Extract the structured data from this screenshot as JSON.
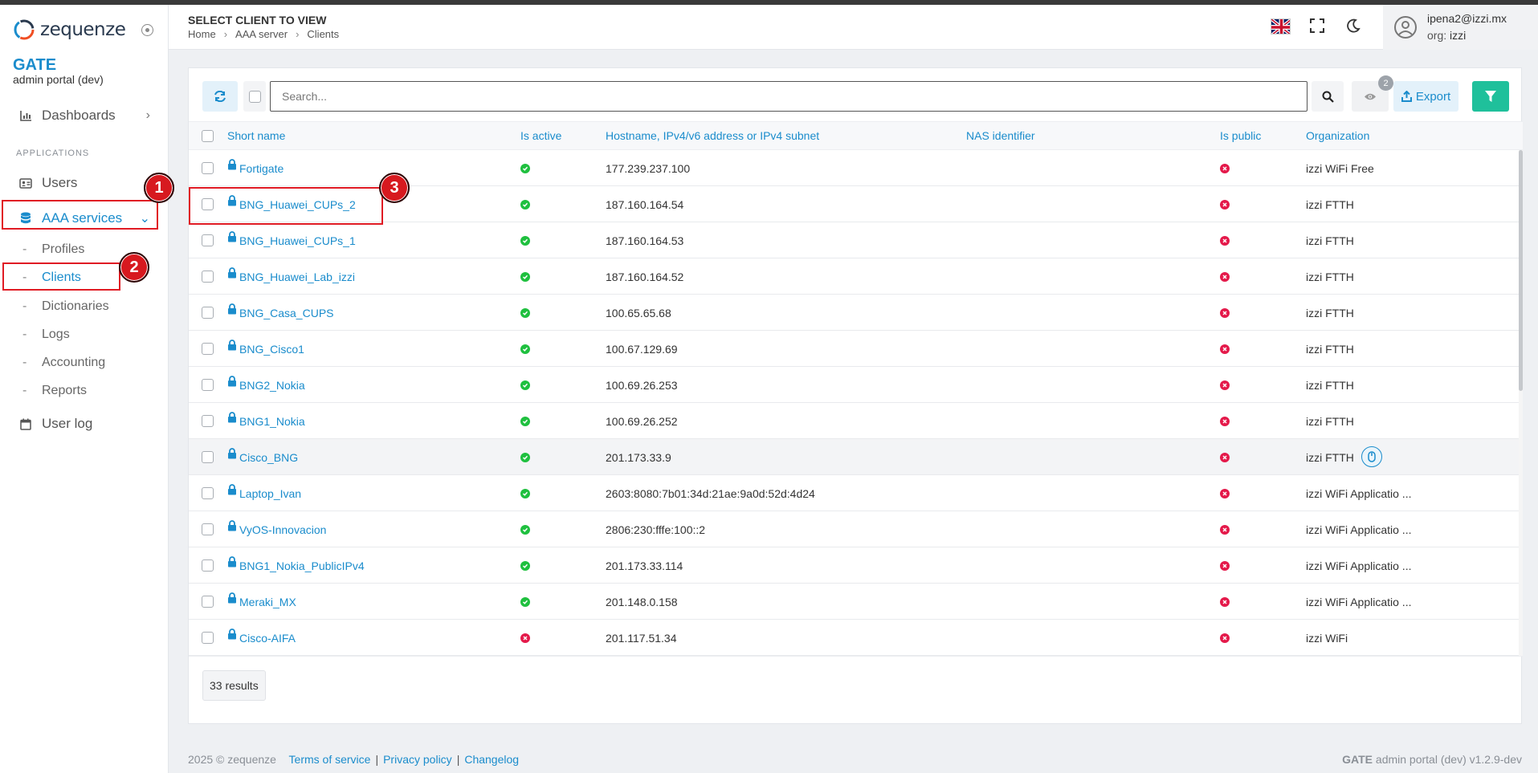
{
  "app": {
    "logo_text": "zequenze",
    "brand": "GATE",
    "brand_sub": "admin portal (dev)"
  },
  "sidebar": {
    "section_label": "APPLICATIONS",
    "items": [
      {
        "label": "Dashboards",
        "icon": "chart-icon"
      },
      {
        "label": "Users",
        "icon": "id-card-icon"
      },
      {
        "label": "AAA services",
        "icon": "database-icon"
      },
      {
        "label": "User log",
        "icon": "calendar-icon"
      }
    ],
    "sub_items": [
      {
        "label": "Profiles"
      },
      {
        "label": "Clients"
      },
      {
        "label": "Dictionaries"
      },
      {
        "label": "Logs"
      },
      {
        "label": "Accounting"
      },
      {
        "label": "Reports"
      }
    ]
  },
  "header": {
    "title": "SELECT CLIENT TO VIEW",
    "breadcrumb": [
      "Home",
      "AAA server",
      "Clients"
    ],
    "user_email": "ipena2@izzi.mx",
    "org_label": "org:",
    "org_value": "izzi"
  },
  "toolbar": {
    "search_placeholder": "Search...",
    "hidden_columns_count": "2",
    "export_label": "Export"
  },
  "table": {
    "columns": [
      "Short name",
      "Is active",
      "Hostname, IPv4/v6 address or IPv4 subnet",
      "NAS identifier",
      "Is public",
      "Organization"
    ],
    "rows": [
      {
        "name": "Fortigate",
        "active": true,
        "host": "177.239.237.100",
        "nas": "",
        "public": false,
        "org": "izzi WiFi Free"
      },
      {
        "name": "BNG_Huawei_CUPs_2",
        "active": true,
        "host": "187.160.164.54",
        "nas": "",
        "public": false,
        "org": "izzi FTTH"
      },
      {
        "name": "BNG_Huawei_CUPs_1",
        "active": true,
        "host": "187.160.164.53",
        "nas": "",
        "public": false,
        "org": "izzi FTTH"
      },
      {
        "name": "BNG_Huawei_Lab_izzi",
        "active": true,
        "host": "187.160.164.52",
        "nas": "",
        "public": false,
        "org": "izzi FTTH"
      },
      {
        "name": "BNG_Casa_CUPS",
        "active": true,
        "host": "100.65.65.68",
        "nas": "",
        "public": false,
        "org": "izzi FTTH"
      },
      {
        "name": "BNG_Cisco1",
        "active": true,
        "host": "100.67.129.69",
        "nas": "",
        "public": false,
        "org": "izzi FTTH"
      },
      {
        "name": "BNG2_Nokia",
        "active": true,
        "host": "100.69.26.253",
        "nas": "",
        "public": false,
        "org": "izzi FTTH"
      },
      {
        "name": "BNG1_Nokia",
        "active": true,
        "host": "100.69.26.252",
        "nas": "",
        "public": false,
        "org": "izzi FTTH"
      },
      {
        "name": "Cisco_BNG",
        "active": true,
        "host": "201.173.33.9",
        "nas": "",
        "public": false,
        "org": "izzi FTTH"
      },
      {
        "name": "Laptop_Ivan",
        "active": true,
        "host": "2603:8080:7b01:34d:21ae:9a0d:52d:4d24",
        "nas": "",
        "public": false,
        "org": "izzi WiFi Applicatio ..."
      },
      {
        "name": "VyOS-Innovacion",
        "active": true,
        "host": "2806:230:fffe:100::2",
        "nas": "",
        "public": false,
        "org": "izzi WiFi Applicatio ..."
      },
      {
        "name": "BNG1_Nokia_PublicIPv4",
        "active": true,
        "host": "201.173.33.114",
        "nas": "",
        "public": false,
        "org": "izzi WiFi Applicatio ..."
      },
      {
        "name": "Meraki_MX",
        "active": true,
        "host": "201.148.0.158",
        "nas": "",
        "public": false,
        "org": "izzi WiFi Applicatio ..."
      },
      {
        "name": "Cisco-AIFA",
        "active": false,
        "host": "201.117.51.34",
        "nas": "",
        "public": false,
        "org": "izzi WiFi"
      }
    ],
    "results_label": "33 results"
  },
  "annotations": [
    "1",
    "2",
    "3"
  ],
  "footer": {
    "copyright": "2025 © zequenze",
    "links": [
      "Terms of service",
      "Privacy policy",
      "Changelog"
    ],
    "version_brand": "GATE",
    "version_text": "admin portal (dev) v1.2.9-dev"
  },
  "colors": {
    "accent": "#1a8ccc",
    "success": "#1fc03f",
    "danger": "#e4194a",
    "filter_button": "#1fc09b",
    "annotation": "#e01b24"
  }
}
